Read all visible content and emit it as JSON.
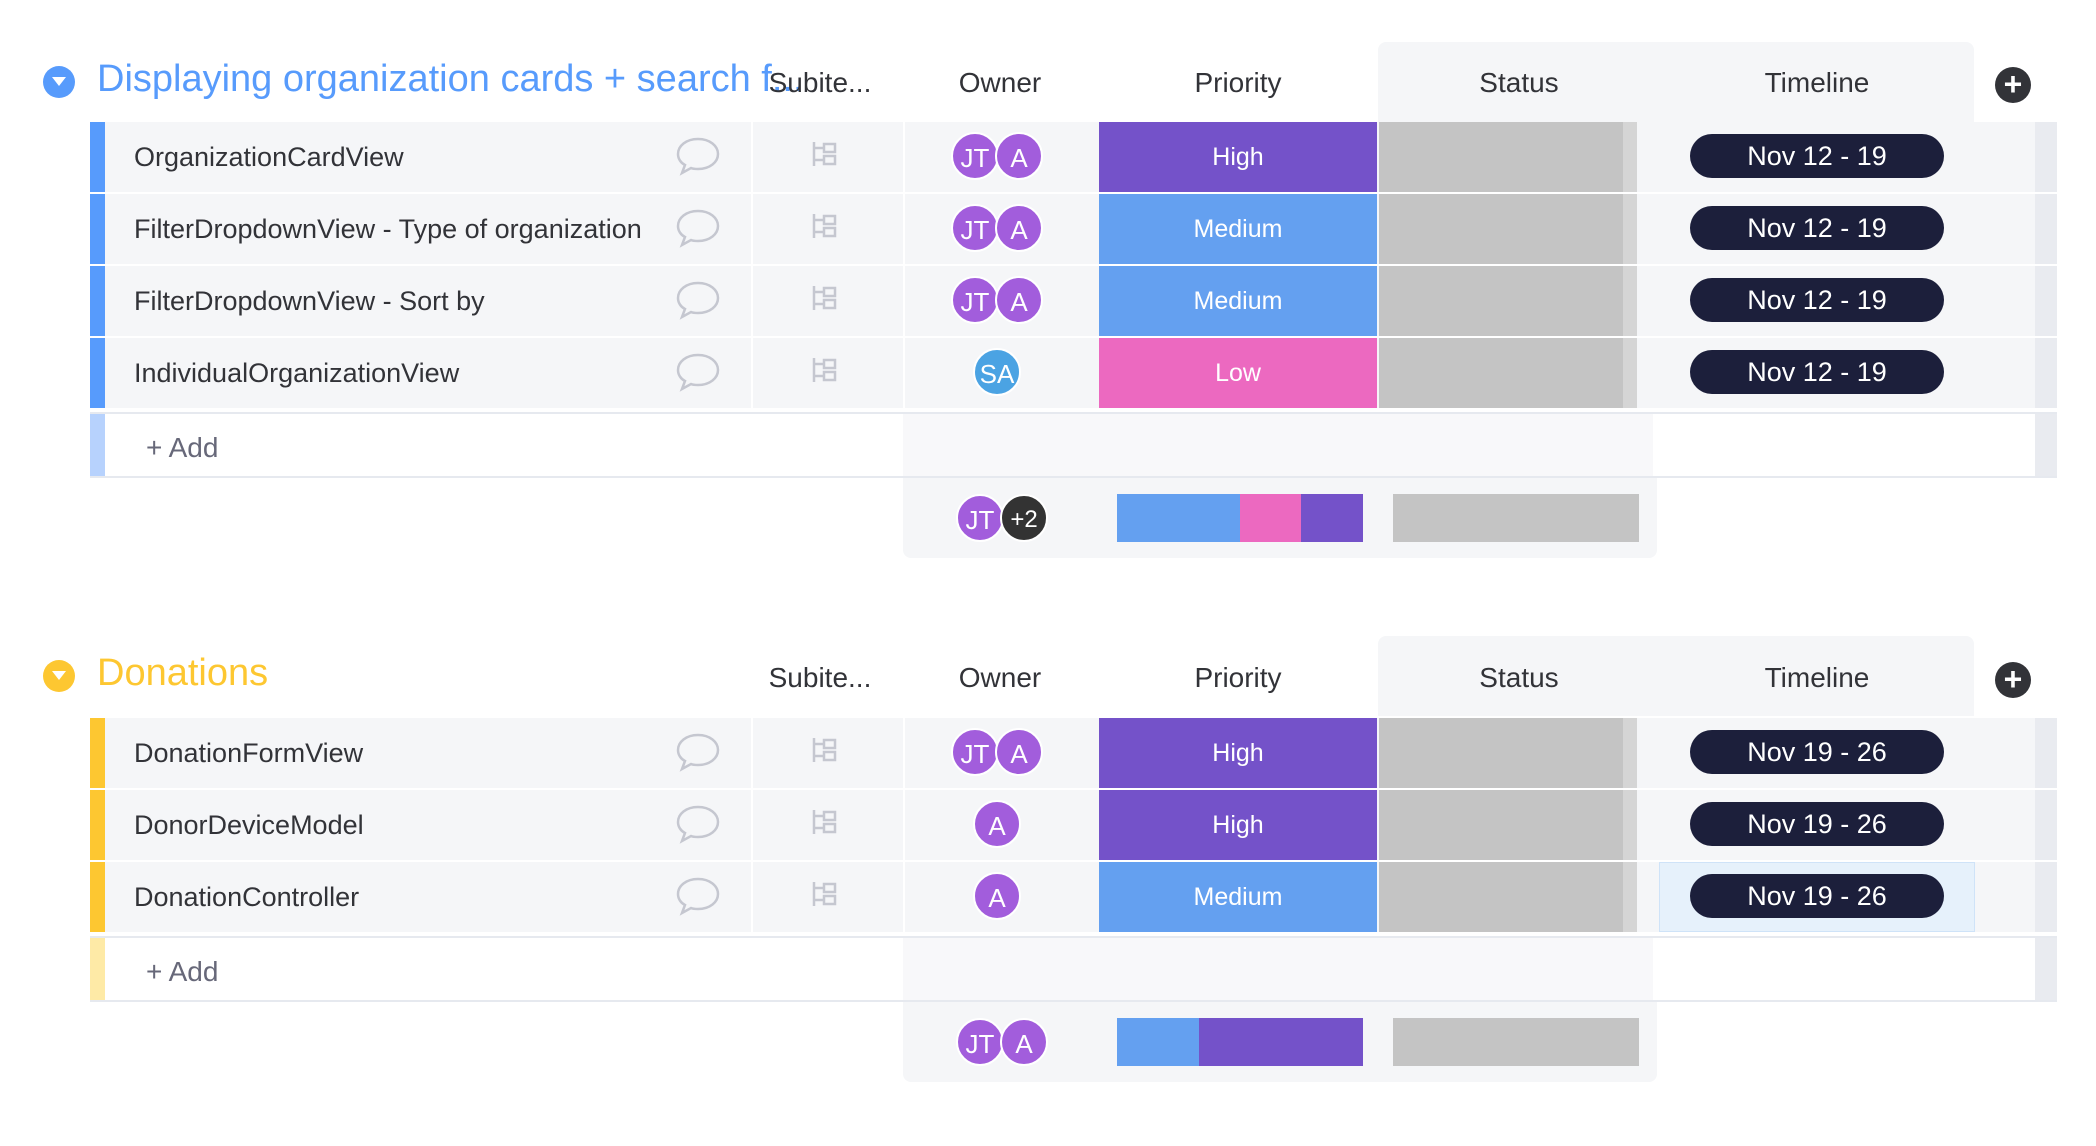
{
  "colors": {
    "high": "#7452c9",
    "medium": "#64a0f0",
    "low": "#ec69c0",
    "status_empty": "#c4c4c4",
    "group1": "#579bfc",
    "group2": "#fdc731",
    "timeline_pill": "#1c1f3b"
  },
  "columns": {
    "subitems": "Subite...",
    "owner": "Owner",
    "priority": "Priority",
    "status": "Status",
    "timeline": "Timeline"
  },
  "add_item_label": "+ Add",
  "groups": [
    {
      "title": "Displaying organization cards + search f...",
      "rows": [
        {
          "name": "OrganizationCardView",
          "owners": [
            "JT",
            "A"
          ],
          "priority": "High",
          "timeline": "Nov 12 - 19"
        },
        {
          "name": "FilterDropdownView - Type of organization",
          "owners": [
            "JT",
            "A"
          ],
          "priority": "Medium",
          "timeline": "Nov 12 - 19"
        },
        {
          "name": "FilterDropdownView - Sort by",
          "owners": [
            "JT",
            "A"
          ],
          "priority": "Medium",
          "timeline": "Nov 12 - 19"
        },
        {
          "name": "IndividualOrganizationView",
          "owners": [
            "SA"
          ],
          "priority": "Low",
          "timeline": "Nov 12 - 19"
        }
      ],
      "summary_owners": [
        "JT",
        "+2"
      ],
      "priority_distribution": [
        {
          "label": "Medium",
          "fraction": 0.5
        },
        {
          "label": "Low",
          "fraction": 0.25
        },
        {
          "label": "High",
          "fraction": 0.25
        }
      ]
    },
    {
      "title": "Donations",
      "rows": [
        {
          "name": "DonationFormView",
          "owners": [
            "JT",
            "A"
          ],
          "priority": "High",
          "timeline": "Nov 19 - 26"
        },
        {
          "name": "DonorDeviceModel",
          "owners": [
            "A"
          ],
          "priority": "High",
          "timeline": "Nov 19 - 26"
        },
        {
          "name": "DonationController",
          "owners": [
            "A"
          ],
          "priority": "Medium",
          "timeline": "Nov 19 - 26",
          "timeline_selected": true
        }
      ],
      "summary_owners": [
        "JT",
        "A"
      ],
      "priority_distribution": [
        {
          "label": "Medium",
          "fraction": 0.333
        },
        {
          "label": "High",
          "fraction": 0.667
        }
      ]
    }
  ]
}
